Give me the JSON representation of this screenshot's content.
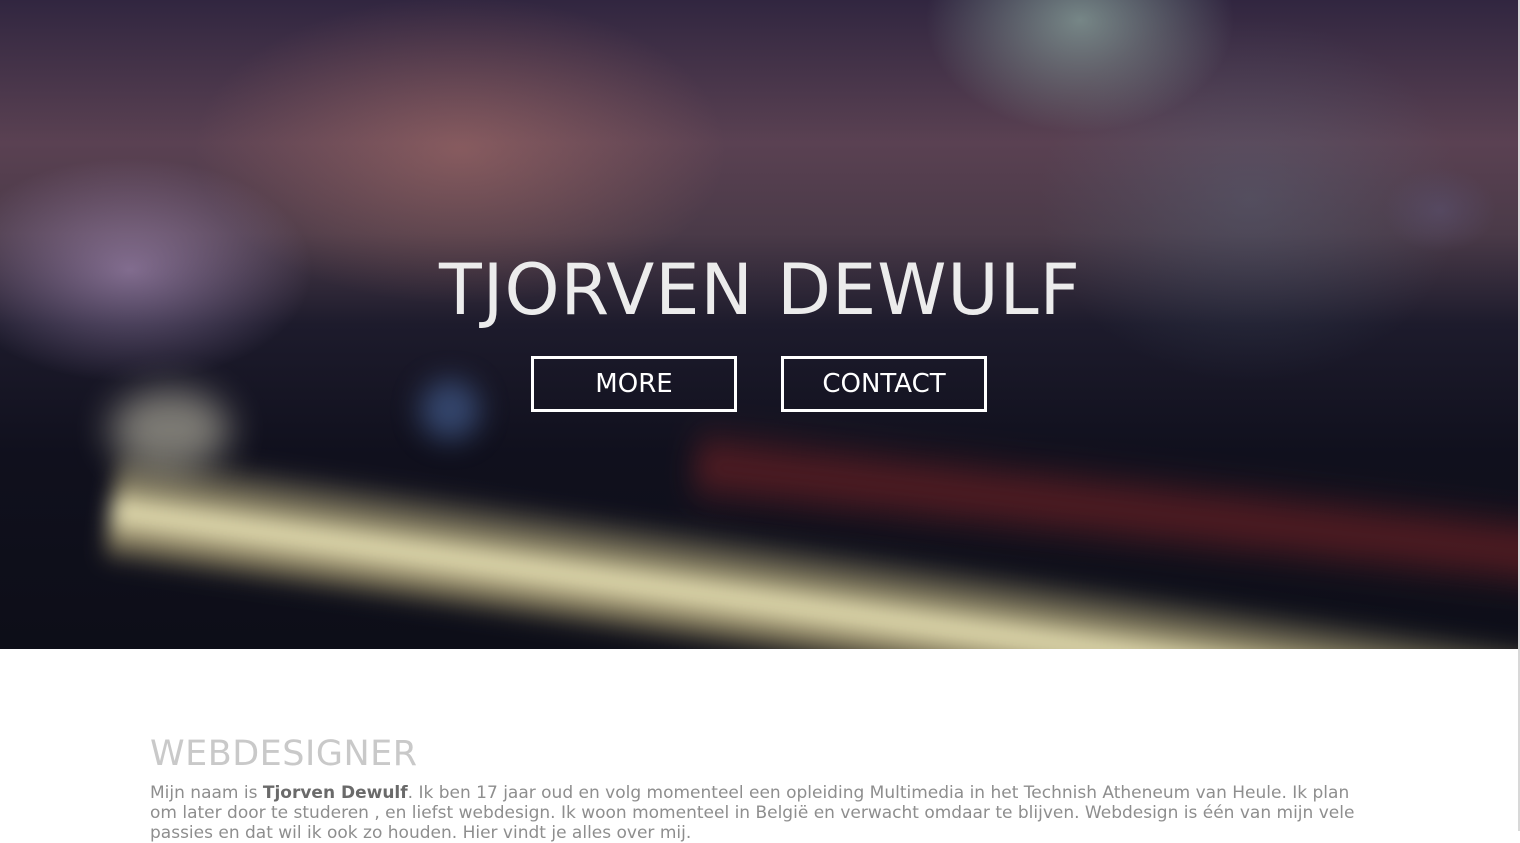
{
  "hero": {
    "title": "TJORVEN DEWULF",
    "more_label": "MORE",
    "contact_label": "CONTACT"
  },
  "about": {
    "title": "WEBDESIGNER",
    "intro_before": "Mijn naam is ",
    "intro_name": "Tjorven Dewulf",
    "intro_after": ". Ik ben 17 jaar oud en volg momenteel een opleiding Multimedia in het Technish Atheneum van Heule. Ik plan om later door te studeren , en liefst webdesign. Ik woon momenteel in België en verwacht omdaar te blijven. Webdesign is één van mijn vele passies en dat wil ik ook zo houden. Hier vindt je alles over mij."
  },
  "colors": {
    "hero_text": "#ececec",
    "button_border": "#ffffff",
    "section_title": "#c9c9c9",
    "body_text": "#8e8e8e"
  }
}
